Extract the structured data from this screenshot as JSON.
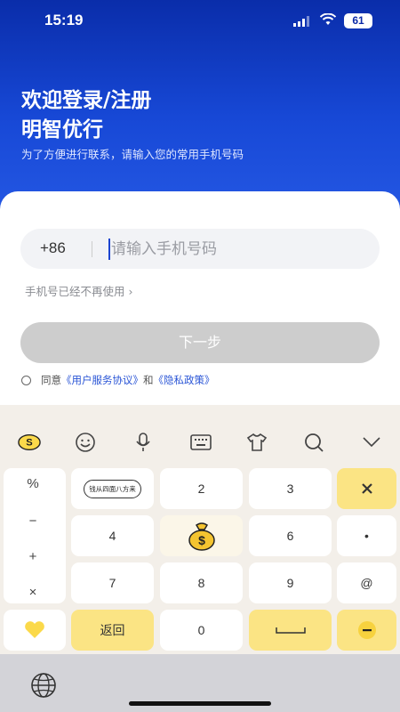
{
  "status_bar": {
    "time": "15:19",
    "battery": "61"
  },
  "header": {
    "title_line1": "欢迎登录/注册",
    "title_line2": "明智优行",
    "subtitle": "为了方便进行联系，请输入您的常用手机号码"
  },
  "login": {
    "country_code": "+86",
    "phone_placeholder": "请输入手机号码",
    "phone_value": "",
    "no_longer_used": "手机号已经不再使用 ›",
    "next_button": "下一步",
    "agree_prefix": "同意",
    "user_agreement": "《用户服务协议》",
    "agree_and": "和",
    "privacy_policy": "《隐私政策》"
  },
  "keyboard": {
    "symbols": [
      "%",
      "−",
      "+",
      "×"
    ],
    "sticker_text": "钱从四面八方来",
    "keys": {
      "k2": "2",
      "k3": "3",
      "k4": "4",
      "k6": "6",
      "k7": "7",
      "k8": "8",
      "k9": "9",
      "dot": "•",
      "at": "@",
      "zero": "0",
      "back": "返回",
      "space": "⎵",
      "delete": "×",
      "minus": "-"
    },
    "icons": [
      "sogou-logo-icon",
      "emoji-icon",
      "microphone-icon",
      "keyboard-icon",
      "shirt-icon",
      "search-icon",
      "collapse-icon"
    ]
  },
  "colors": {
    "brand_blue": "#1748d6",
    "link": "#2a55d6",
    "key_yellow": "#fbe484"
  }
}
